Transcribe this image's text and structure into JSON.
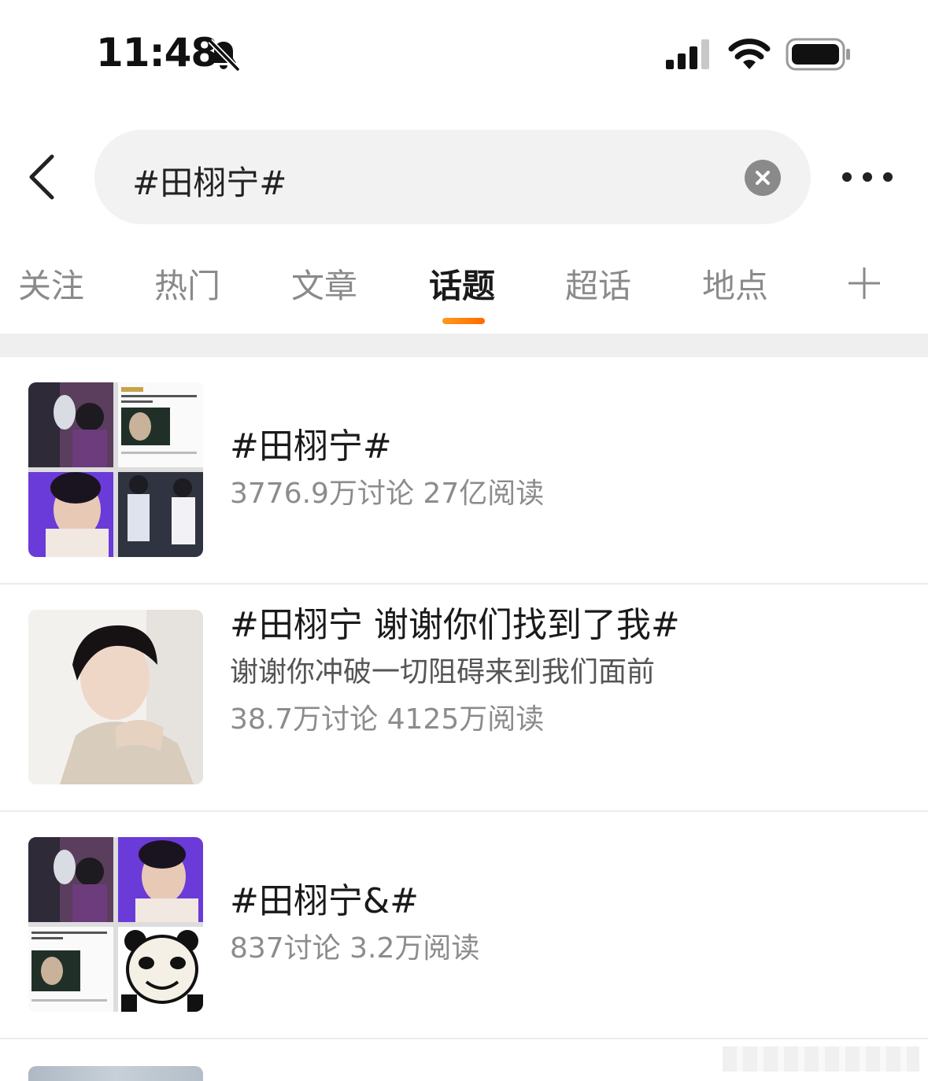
{
  "status_bar": {
    "time": "11:48",
    "icons": [
      "bell-slash-icon",
      "cellular-signal-icon",
      "wifi-icon",
      "battery-icon"
    ]
  },
  "search": {
    "query": "#田栩宁#",
    "icons": [
      "back-arrow-icon",
      "clear-icon",
      "more-dots-icon"
    ]
  },
  "tabs": [
    {
      "label": "关注",
      "active": false
    },
    {
      "label": "热门",
      "active": false
    },
    {
      "label": "文章",
      "active": false
    },
    {
      "label": "话题",
      "active": true
    },
    {
      "label": "超话",
      "active": false
    },
    {
      "label": "地点",
      "active": false
    }
  ],
  "accent_color": "#ff7a00",
  "topics": [
    {
      "title": "#田栩宁#",
      "description": "",
      "stats": "3776.9万讨论 27亿阅读",
      "thumbnail": "collage-image"
    },
    {
      "title": "#田栩宁 谢谢你们找到了我#",
      "description": "谢谢你冲破一切阻碍来到我们面前",
      "stats": "38.7万讨论 4125万阅读",
      "thumbnail": "portrait-image"
    },
    {
      "title": "#田栩宁&#",
      "description": "",
      "stats": "837讨论 3.2万阅读",
      "thumbnail": "collage-image"
    }
  ]
}
